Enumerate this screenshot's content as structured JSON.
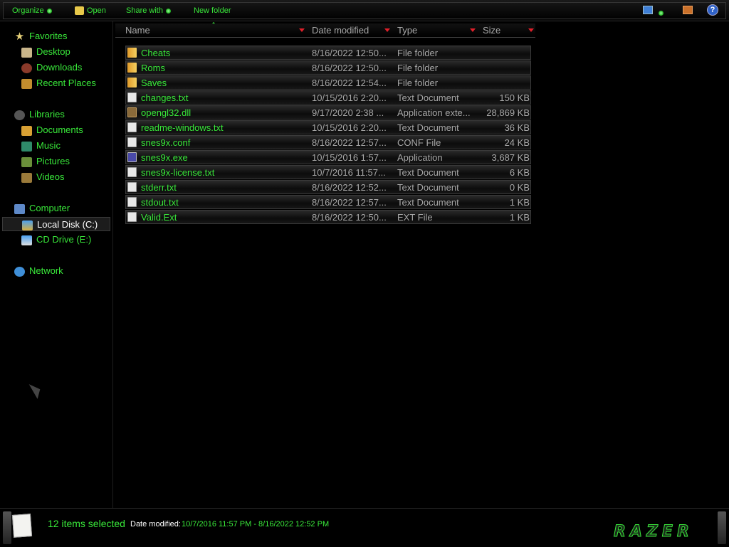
{
  "toolbar": {
    "organize": "Organize",
    "open": "Open",
    "share_with": "Share with",
    "new_folder": "New folder",
    "help": "?"
  },
  "nav": {
    "favorites": {
      "label": "Favorites",
      "items": [
        "Desktop",
        "Downloads",
        "Recent Places"
      ]
    },
    "libraries": {
      "label": "Libraries",
      "items": [
        "Documents",
        "Music",
        "Pictures",
        "Videos"
      ]
    },
    "computer": {
      "label": "Computer",
      "items": [
        "Local Disk (C:)",
        "CD Drive (E:)"
      ],
      "selected": "Local Disk (C:)"
    },
    "network": {
      "label": "Network"
    }
  },
  "columns": {
    "name": "Name",
    "date": "Date modified",
    "type": "Type",
    "size": "Size"
  },
  "files": [
    {
      "name": "Cheats",
      "date": "8/16/2022 12:50...",
      "type": "File folder",
      "size": "",
      "icon": "folder-icon"
    },
    {
      "name": "Roms",
      "date": "8/16/2022 12:50...",
      "type": "File folder",
      "size": "",
      "icon": "folder-icon"
    },
    {
      "name": "Saves",
      "date": "8/16/2022 12:54...",
      "type": "File folder",
      "size": "",
      "icon": "folder-icon"
    },
    {
      "name": "changes.txt",
      "date": "10/15/2016 2:20...",
      "type": "Text Document",
      "size": "150 KB",
      "icon": "text-file-icon"
    },
    {
      "name": "opengl32.dll",
      "date": "9/17/2020 2:38 ...",
      "type": "Application exte...",
      "size": "28,869 KB",
      "icon": "dll-file-icon"
    },
    {
      "name": "readme-windows.txt",
      "date": "10/15/2016 2:20...",
      "type": "Text Document",
      "size": "36 KB",
      "icon": "text-file-icon"
    },
    {
      "name": "snes9x.conf",
      "date": "8/16/2022 12:57...",
      "type": "CONF File",
      "size": "24 KB",
      "icon": "text-file-icon"
    },
    {
      "name": "snes9x.exe",
      "date": "10/15/2016 1:57...",
      "type": "Application",
      "size": "3,687 KB",
      "icon": "exe-file-icon"
    },
    {
      "name": "snes9x-license.txt",
      "date": "10/7/2016 11:57...",
      "type": "Text Document",
      "size": "6 KB",
      "icon": "text-file-icon"
    },
    {
      "name": "stderr.txt",
      "date": "8/16/2022 12:52...",
      "type": "Text Document",
      "size": "0 KB",
      "icon": "text-file-icon"
    },
    {
      "name": "stdout.txt",
      "date": "8/16/2022 12:57...",
      "type": "Text Document",
      "size": "1 KB",
      "icon": "text-file-icon"
    },
    {
      "name": "Valid.Ext",
      "date": "8/16/2022 12:50...",
      "type": "EXT File",
      "size": "1 KB",
      "icon": "text-file-icon"
    }
  ],
  "status": {
    "selected": "12 items selected",
    "date_label": "Date modified:",
    "date_range": "10/7/2016 11:57 PM - 8/16/2022 12:52 PM",
    "brand": "RAZER"
  },
  "colors": {
    "accent": "#39e83a",
    "text_secondary": "#a8a8a8",
    "sort_arrow": "#e0202a"
  }
}
